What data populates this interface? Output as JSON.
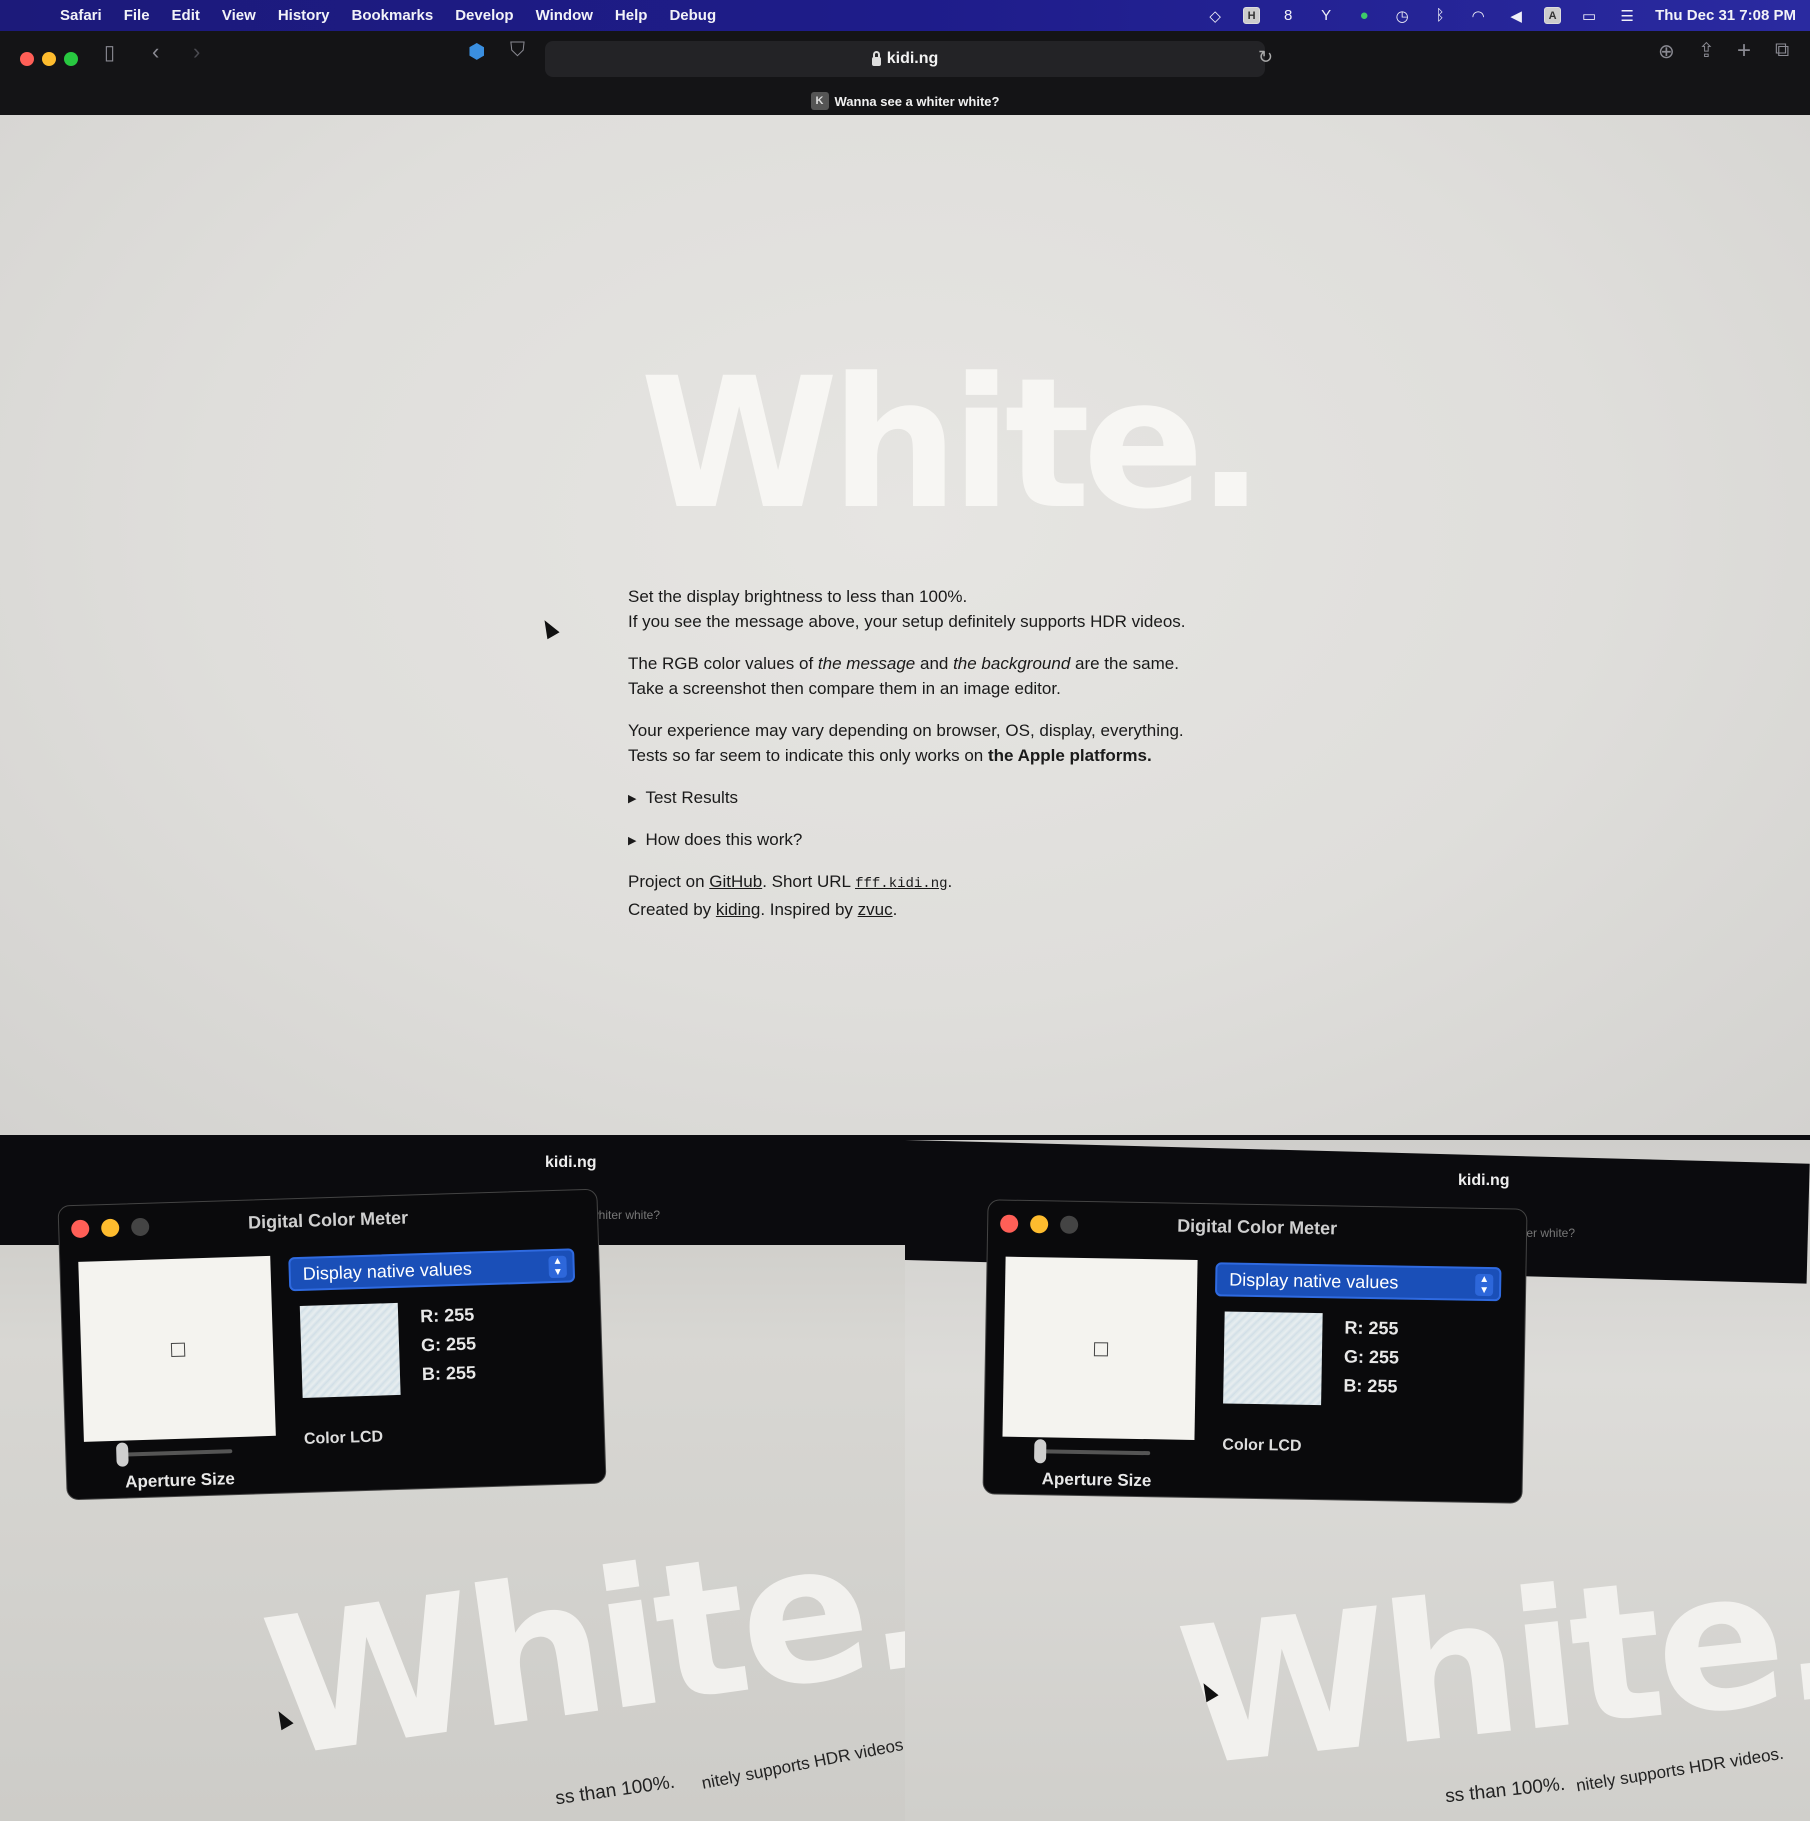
{
  "menubar": {
    "app": "Safari",
    "items": [
      "File",
      "Edit",
      "View",
      "History",
      "Bookmarks",
      "Develop",
      "Window",
      "Help",
      "Debug"
    ],
    "clock": "Thu Dec 31  7:08 PM"
  },
  "browser": {
    "url": "kidi.ng",
    "tab_title": "Wanna see a whiter white?",
    "tab_favicon": "K"
  },
  "page": {
    "headline": "White.",
    "p1_line1": "Set the display brightness to less than 100%.",
    "p1_line2": "If you see the message above, your setup definitely supports HDR videos.",
    "p2_a": "The RGB color values of ",
    "p2_em1": "the message",
    "p2_b": " and ",
    "p2_em2": "the background",
    "p2_c": " are the same.",
    "p2_line2": "Take a screenshot then compare them in an image editor.",
    "p3_line1": "Your experience may vary depending on browser, OS, display, everything.",
    "p3_line2_a": "Tests so far seem to indicate this only works on ",
    "p3_line2_strong": "the Apple platforms.",
    "details1": "Test Results",
    "details2": "How does this work?",
    "f1_a": "Project on ",
    "f1_link": "GitHub",
    "f1_b": ". Short URL ",
    "f1_code": "fff.kidi.ng",
    "f1_c": ".",
    "f2_a": "Created by ",
    "f2_link1": "kiding",
    "f2_b": ". Inspired by ",
    "f2_link2": "zvuc",
    "f2_c": "."
  },
  "photos": [
    {
      "url": "kidi.ng",
      "ghost_tab": "whiter white?",
      "headline": "White.",
      "foot1": "ss than 100%.",
      "foot2": "nitely supports HDR videos.",
      "meter": {
        "title": "Digital Color Meter",
        "mode": "Display native values",
        "r": "R:  255",
        "g": "G:  255",
        "b": "B:  255",
        "profile": "Color LCD",
        "aperture": "Aperture Size"
      }
    },
    {
      "url": "kidi.ng",
      "ghost_tab": "whiter white?",
      "headline": "White.",
      "foot1": "ss than 100%.",
      "foot2": "nitely supports HDR videos.",
      "meter": {
        "title": "Digital Color Meter",
        "mode": "Display native values",
        "r": "R:  255",
        "g": "G:  255",
        "b": "B:  255",
        "profile": "Color LCD",
        "aperture": "Aperture Size"
      }
    }
  ],
  "colors": {
    "menubar_bg": "#1e1c8a",
    "traffic_red": "#ff5f57",
    "traffic_yellow": "#febc2e",
    "traffic_green": "#28c840",
    "select_blue": "#1a4fb8"
  },
  "icons": [
    "apple-icon",
    "sidebar-icon",
    "back-icon",
    "forward-icon",
    "extension-icon",
    "shield-icon",
    "reload-icon",
    "download-icon",
    "share-icon",
    "new-tab-icon",
    "tabs-overview-icon",
    "wifi-icon",
    "bluetooth-icon",
    "volume-icon",
    "battery-icon",
    "control-center-icon"
  ]
}
